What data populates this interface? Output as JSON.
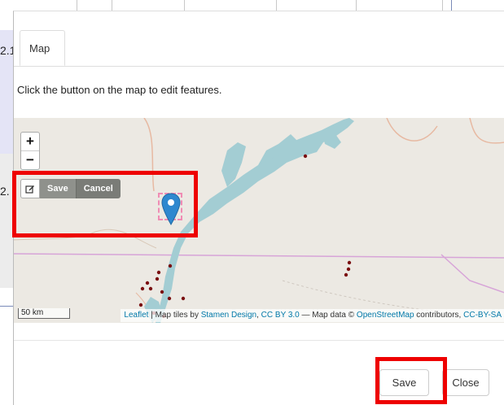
{
  "background": {
    "row_numbers": [
      "2.1",
      "2."
    ]
  },
  "dialog": {
    "tab_label": "Map",
    "instruction": "Click the button on the map to edit features."
  },
  "map": {
    "zoom_in": "+",
    "zoom_out": "−",
    "edit_icon": "edit-icon",
    "save_label": "Save",
    "cancel_label": "Cancel",
    "scale_label": "50 km",
    "attribution": {
      "leaflet": "Leaflet",
      "tiles_prefix": " | Map tiles by ",
      "stamen": "Stamen Design",
      "comma": ", ",
      "ccby": "CC BY 3.0",
      "data_prefix": " — Map data © ",
      "osm": "OpenStreetMap",
      "contributors": " contributors, ",
      "ccbysa": "CC-BY-SA"
    },
    "colors": {
      "water": "#a3cdd3",
      "border": "#d7a4d8",
      "marker": "#2e88cf",
      "dots": "#7a0e10"
    }
  },
  "footer": {
    "save_label": "Save",
    "close_label": "Close"
  },
  "annotations": {
    "highlight_color": "#ee0000"
  }
}
